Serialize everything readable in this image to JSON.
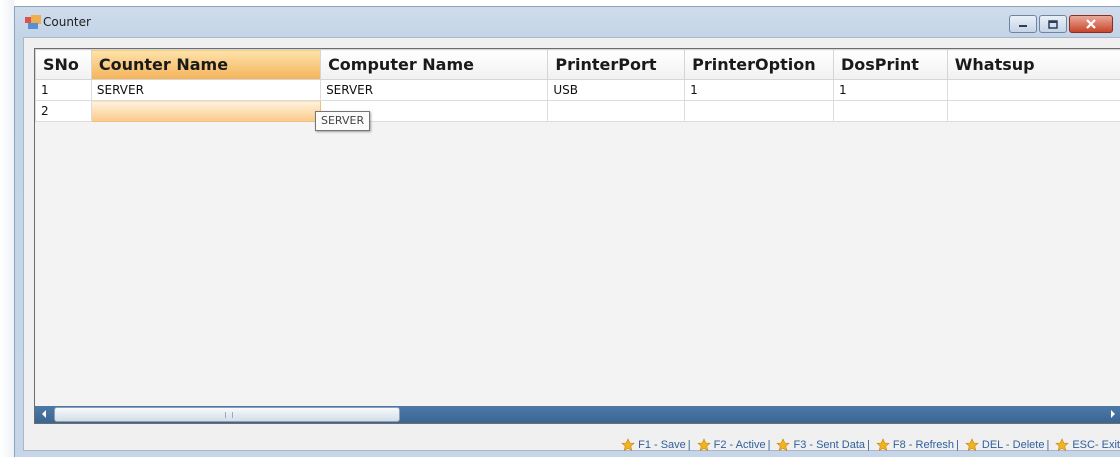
{
  "window": {
    "title": "Counter",
    "icon": "app-icon",
    "controls": [
      "minimize-icon",
      "maximize-icon",
      "close-icon"
    ],
    "accent_color": "#f4b35a"
  },
  "grid": {
    "columns": [
      "SNo",
      "Counter Name",
      "Computer Name",
      "PrinterPort",
      "PrinterOption",
      "DosPrint",
      "Whatsup"
    ],
    "selected_column": "Counter Name",
    "rows": [
      [
        "1",
        "SERVER",
        "SERVER",
        "USB",
        "1",
        "1",
        ""
      ],
      [
        "2",
        "",
        "",
        "",
        "",
        "",
        ""
      ]
    ],
    "tooltip": "SERVER"
  },
  "shortcuts": [
    {
      "label": "F1 - Save",
      "sep": "|"
    },
    {
      "label": "F2 - Active",
      "sep": "|"
    },
    {
      "label": "F3 - Sent Data",
      "sep": "|"
    },
    {
      "label": "F8 - Refresh",
      "sep": "|"
    },
    {
      "label": "DEL - Delete",
      "sep": "|"
    },
    {
      "label": "ESC- Exit",
      "sep": ""
    }
  ]
}
